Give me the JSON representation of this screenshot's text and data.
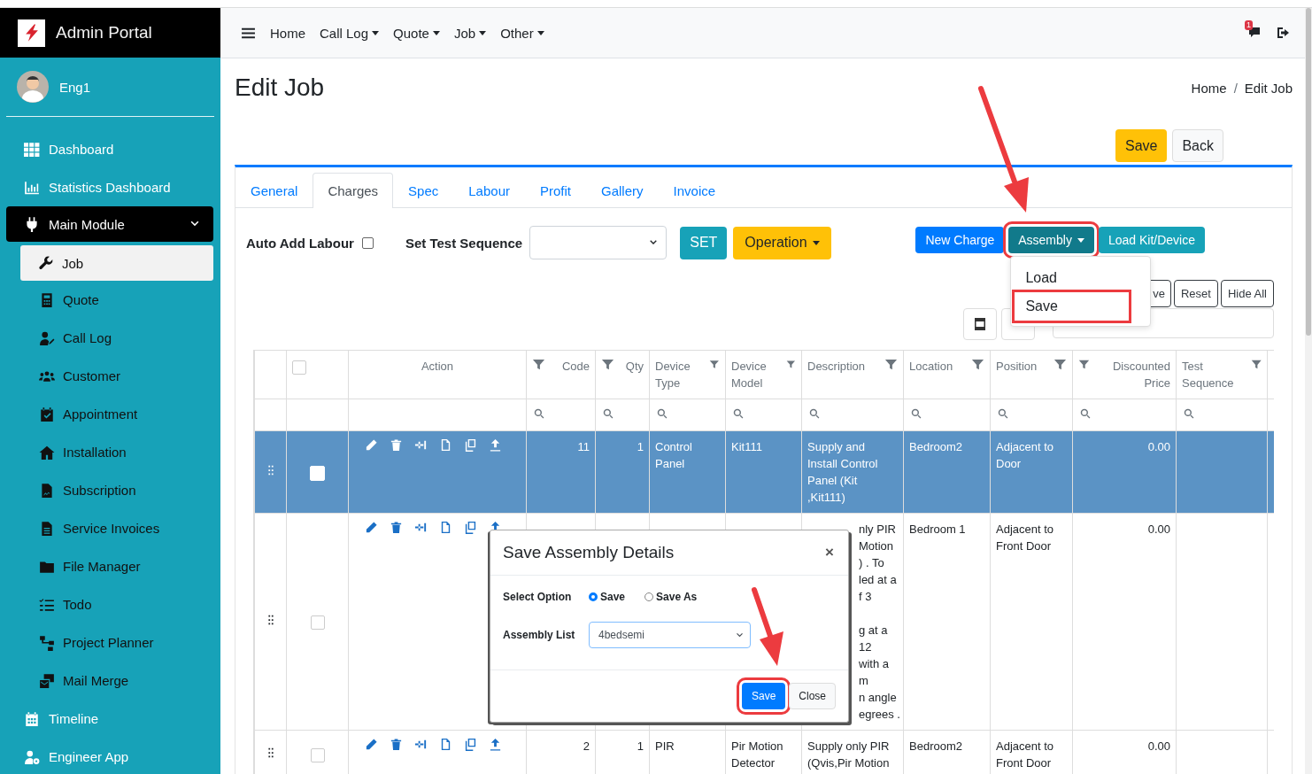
{
  "brand": {
    "title": "Admin Portal"
  },
  "user": {
    "name": "Eng1"
  },
  "sidebar": {
    "items": [
      {
        "label": "Dashboard",
        "selected": false
      },
      {
        "label": "Statistics Dashboard",
        "selected": false
      },
      {
        "label": "Main Module",
        "selected": true,
        "expanded": true,
        "children": [
          {
            "label": "Job",
            "selected": true
          },
          {
            "label": "Quote",
            "selected": false
          },
          {
            "label": "Call Log",
            "selected": false
          },
          {
            "label": "Customer",
            "selected": false
          },
          {
            "label": "Appointment",
            "selected": false
          },
          {
            "label": "Installation",
            "selected": false
          },
          {
            "label": "Subscription",
            "selected": false
          },
          {
            "label": "Service Invoices",
            "selected": false
          },
          {
            "label": "File Manager",
            "selected": false
          },
          {
            "label": "Todo",
            "selected": false
          },
          {
            "label": "Project Planner",
            "selected": false
          },
          {
            "label": "Mail Merge",
            "selected": false
          }
        ]
      },
      {
        "label": "Timeline",
        "selected": false
      },
      {
        "label": "Engineer App",
        "selected": false
      }
    ]
  },
  "topbar": {
    "menu": [
      {
        "label": "Home",
        "has_menu": false
      },
      {
        "label": "Call Log",
        "has_menu": true
      },
      {
        "label": "Quote",
        "has_menu": true
      },
      {
        "label": "Job",
        "has_menu": true
      },
      {
        "label": "Other",
        "has_menu": true
      }
    ],
    "notification_count": "1"
  },
  "page": {
    "title": "Edit Job",
    "breadcrumb": [
      "Home",
      "Edit Job"
    ],
    "breadcrumb_separator": "/",
    "buttons": [
      {
        "label": "Save",
        "kind": "warning"
      },
      {
        "label": "Back",
        "kind": "light"
      }
    ]
  },
  "tabs": [
    {
      "label": "General",
      "selected": false
    },
    {
      "label": "Charges",
      "selected": true
    },
    {
      "label": "Spec",
      "selected": false
    },
    {
      "label": "Labour",
      "selected": false
    },
    {
      "label": "Profit",
      "selected": false
    },
    {
      "label": "Gallery",
      "selected": false
    },
    {
      "label": "Invoice",
      "selected": false
    }
  ],
  "toolbar": {
    "auto_add_label": "Auto Add Labour",
    "auto_add_checked": false,
    "test_sequence_label": "Set Test Sequence",
    "set_button": "SET",
    "operation_button": "Operation",
    "actions": [
      {
        "label": "New Charge",
        "kind": "primary",
        "highlighted": false,
        "has_menu": false
      },
      {
        "label": "Assembly",
        "kind": "dark",
        "highlighted": true,
        "has_menu": true
      },
      {
        "label": "Load Kit/Device",
        "kind": "info",
        "highlighted": false,
        "has_menu": false
      }
    ]
  },
  "assembly_menu": [
    {
      "label": "Load",
      "highlighted": false
    },
    {
      "label": "Save",
      "highlighted": true
    }
  ],
  "column_buttons": [
    "ve",
    "Reset",
    "Hide All"
  ],
  "table": {
    "header_checked": false,
    "action_header": "Action",
    "columns": [
      {
        "label": "Code",
        "filter": true
      },
      {
        "label": "Qty",
        "filter": true
      },
      {
        "label": "Device Type",
        "filter": true
      },
      {
        "label": "Device Model",
        "filter": true
      },
      {
        "label": "Description",
        "filter": true
      },
      {
        "label": "Location",
        "filter": true
      },
      {
        "label": "Position",
        "filter": true
      },
      {
        "label": "Discounted Price",
        "filter": true
      },
      {
        "label": "Test Sequence",
        "filter": true
      }
    ],
    "rows": [
      {
        "selected": true,
        "checked": false,
        "cells": [
          "11",
          "1",
          "Control Panel",
          "Kit111",
          "Supply and Install Control Panel (Kit ,Kit111)",
          "Bedroom2",
          "Adjacent to Door",
          "0.00",
          null
        ]
      },
      {
        "selected": false,
        "checked": false,
        "cells": [
          null,
          null,
          null,
          null,
          [
            [
              "nly PIR",
              "Motion",
              ") . To",
              "led at a",
              "f 3"
            ],
            [
              "g at a",
              "12",
              "with a",
              "m",
              "n angle",
              "egrees ."
            ]
          ],
          "Bedroom 1",
          "Adjacent to Front Door",
          "0.00",
          null
        ]
      },
      {
        "selected": false,
        "checked": false,
        "cells": [
          "2",
          "1",
          "PIR",
          "Pir Motion Detector",
          "Supply only PIR (Qvis,Pir Motion",
          "Bedroom2",
          "Adjacent to Front Door",
          "0.00",
          null
        ]
      }
    ]
  },
  "modal": {
    "title": "Save Assembly Details",
    "close_glyph": "×",
    "option_label": "Select Option",
    "options": [
      {
        "label": "Save",
        "selected": true
      },
      {
        "label": "Save As",
        "selected": false
      }
    ],
    "list_label": "Assembly List",
    "list_value": "4bedsemi",
    "buttons": [
      {
        "label": "Save",
        "kind": "primary",
        "highlighted": true
      },
      {
        "label": "Close",
        "kind": "light",
        "highlighted": false
      }
    ]
  }
}
